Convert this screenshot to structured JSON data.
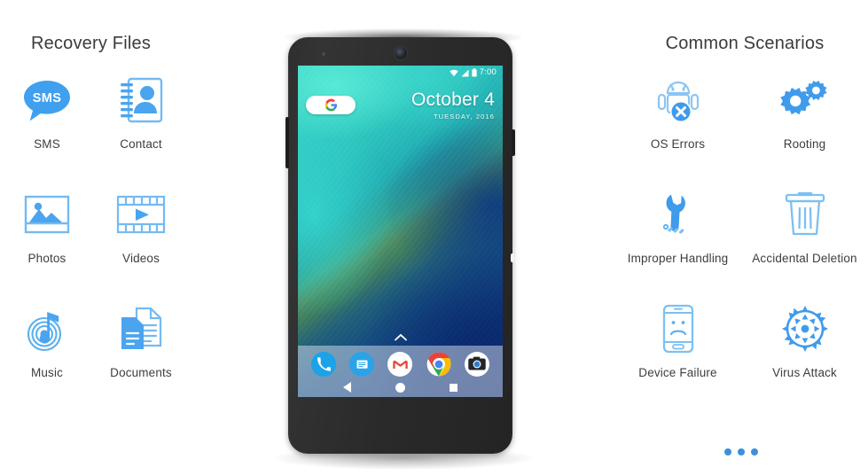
{
  "page": {
    "background_color": "#ffffff",
    "accent_color": "#3f8fdd",
    "icon_blue": "#4a9cf0",
    "icon_outline_blue": "#6cb6ef",
    "label_color": "#3d3d3d"
  },
  "left_panel": {
    "title": "Recovery Files",
    "items": [
      {
        "label": "SMS",
        "icon": "sms-bubble-icon"
      },
      {
        "label": "Contact",
        "icon": "contact-book-icon"
      },
      {
        "label": "Photos",
        "icon": "photo-image-icon"
      },
      {
        "label": "Videos",
        "icon": "video-filmstrip-icon"
      },
      {
        "label": "Music",
        "icon": "music-note-icon"
      },
      {
        "label": "Documents",
        "icon": "documents-icon"
      }
    ]
  },
  "right_panel": {
    "title": "Common Scenarios",
    "items": [
      {
        "label": "Improper Handling",
        "icon": "wrench-screwdriver-icon"
      },
      {
        "label": "OS Errors",
        "icon": "android-error-icon"
      },
      {
        "label": "Rooting",
        "icon": "gears-icon"
      },
      {
        "label": "Accidental Deletion",
        "icon": "trash-can-icon"
      },
      {
        "label": "Device Failure",
        "icon": "phone-sad-face-icon"
      },
      {
        "label": "Virus Attack",
        "icon": "virus-icon"
      }
    ],
    "more_label": "more-scenarios-dots"
  },
  "phone": {
    "device": "android-phone-mockup",
    "status_bar": {
      "time": "7:00",
      "icons": [
        "wifi-icon",
        "signal-icon",
        "battery-icon"
      ]
    },
    "home_screen": {
      "search_widget": "google-g-icon",
      "date_primary": "October 4",
      "date_secondary": "TUESDAY, 2016",
      "app_drawer_handle": "chevron-up-icon",
      "dock_apps": [
        {
          "name": "phone-app-icon"
        },
        {
          "name": "messages-app-icon"
        },
        {
          "name": "gmail-app-icon"
        },
        {
          "name": "chrome-app-icon"
        },
        {
          "name": "camera-app-icon"
        }
      ],
      "nav_bar": [
        {
          "name": "nav-back-button"
        },
        {
          "name": "nav-home-button"
        },
        {
          "name": "nav-recents-button"
        }
      ]
    }
  }
}
